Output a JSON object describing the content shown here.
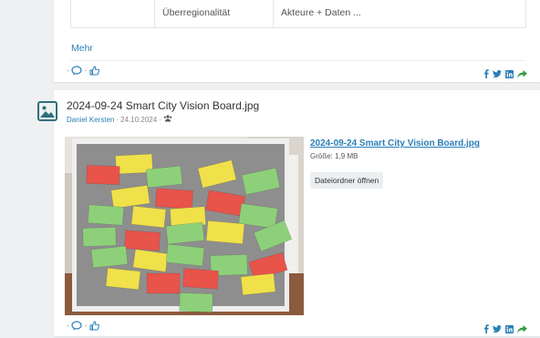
{
  "top_post": {
    "table_row": [
      "",
      "Überregionalität",
      "Akteure + Daten ..."
    ],
    "more_label": "Mehr",
    "action_sep": "·"
  },
  "file_post": {
    "title": "2024-09-24 Smart City Vision Board.jpg",
    "author": "Daniel Kersten",
    "date": "24.10.2024",
    "meta_sep": "·",
    "file_name": "2024-09-24 Smart City Vision Board.jpg",
    "file_size": "Größe: 1,9 MB",
    "open_folder_label": "Dateiordner öffnen",
    "action_sep": "·"
  },
  "icons": {
    "comment": "comment-icon",
    "like": "thumbs-up-icon",
    "facebook": "facebook-icon",
    "twitter": "twitter-icon",
    "linkedin": "linkedin-icon",
    "share": "share-arrow-icon",
    "image_file": "image-file-icon",
    "visibility": "group-visibility-icon"
  },
  "colors": {
    "link": "#2a7fb8",
    "share_green": "#3a9a4a",
    "icon_teal": "#2f6f7a"
  }
}
